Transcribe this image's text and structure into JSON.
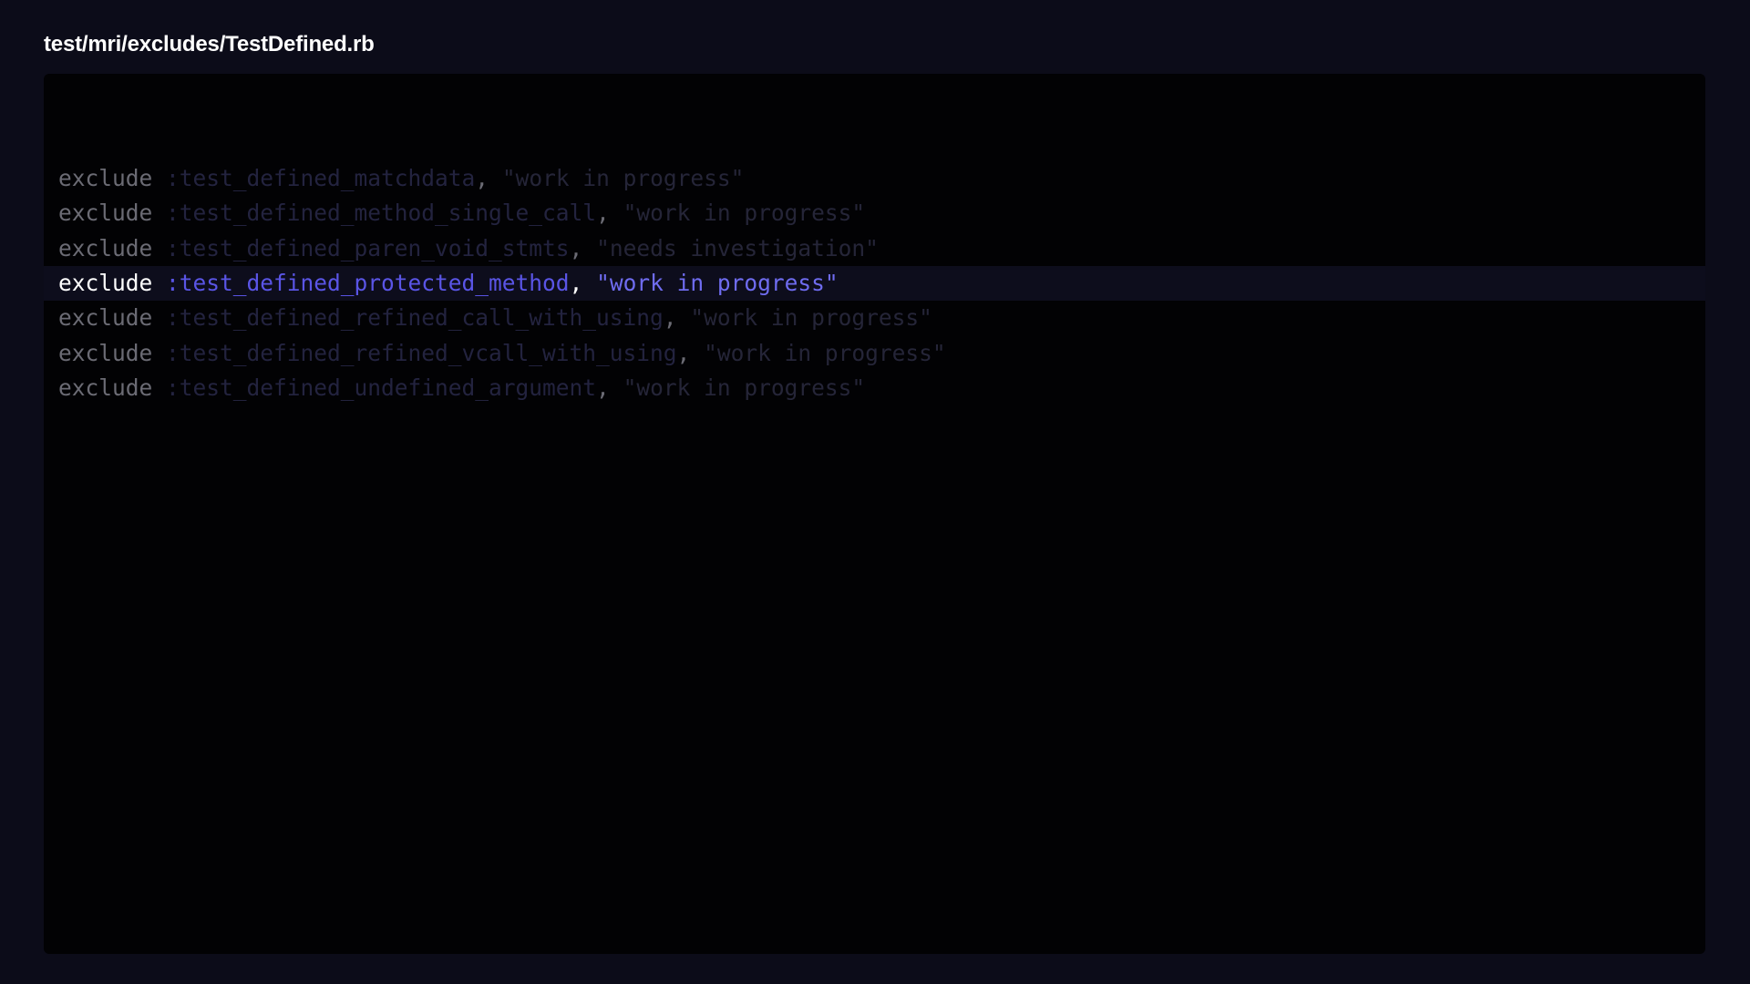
{
  "header": {
    "file_path": "test/mri/excludes/TestDefined.rb"
  },
  "editor": {
    "active_line_index": 3,
    "lines": [
      {
        "keyword": "exclude",
        "symbol": ":test_defined_matchdata",
        "separator": ",",
        "string": "\"work in progress\""
      },
      {
        "keyword": "exclude",
        "symbol": ":test_defined_method_single_call",
        "separator": ",",
        "string": "\"work in progress\""
      },
      {
        "keyword": "exclude",
        "symbol": ":test_defined_paren_void_stmts",
        "separator": ",",
        "string": "\"needs investigation\""
      },
      {
        "keyword": "exclude",
        "symbol": ":test_defined_protected_method",
        "separator": ",",
        "string": "\"work in progress\""
      },
      {
        "keyword": "exclude",
        "symbol": ":test_defined_refined_call_with_using",
        "separator": ",",
        "string": "\"work in progress\""
      },
      {
        "keyword": "exclude",
        "symbol": ":test_defined_refined_vcall_with_using",
        "separator": ",",
        "string": "\"work in progress\""
      },
      {
        "keyword": "exclude",
        "symbol": ":test_defined_undefined_argument",
        "separator": ",",
        "string": "\"work in progress\""
      }
    ]
  },
  "colors": {
    "page_background": "#0c0c19",
    "panel_background": "#020204",
    "active_line_background": "#0d0d1c",
    "active_symbol": "#5a55e6",
    "active_string": "#6f6cf0",
    "dimmed_keyword": "#6b6b74",
    "dimmed_symbol": "#23233f"
  }
}
